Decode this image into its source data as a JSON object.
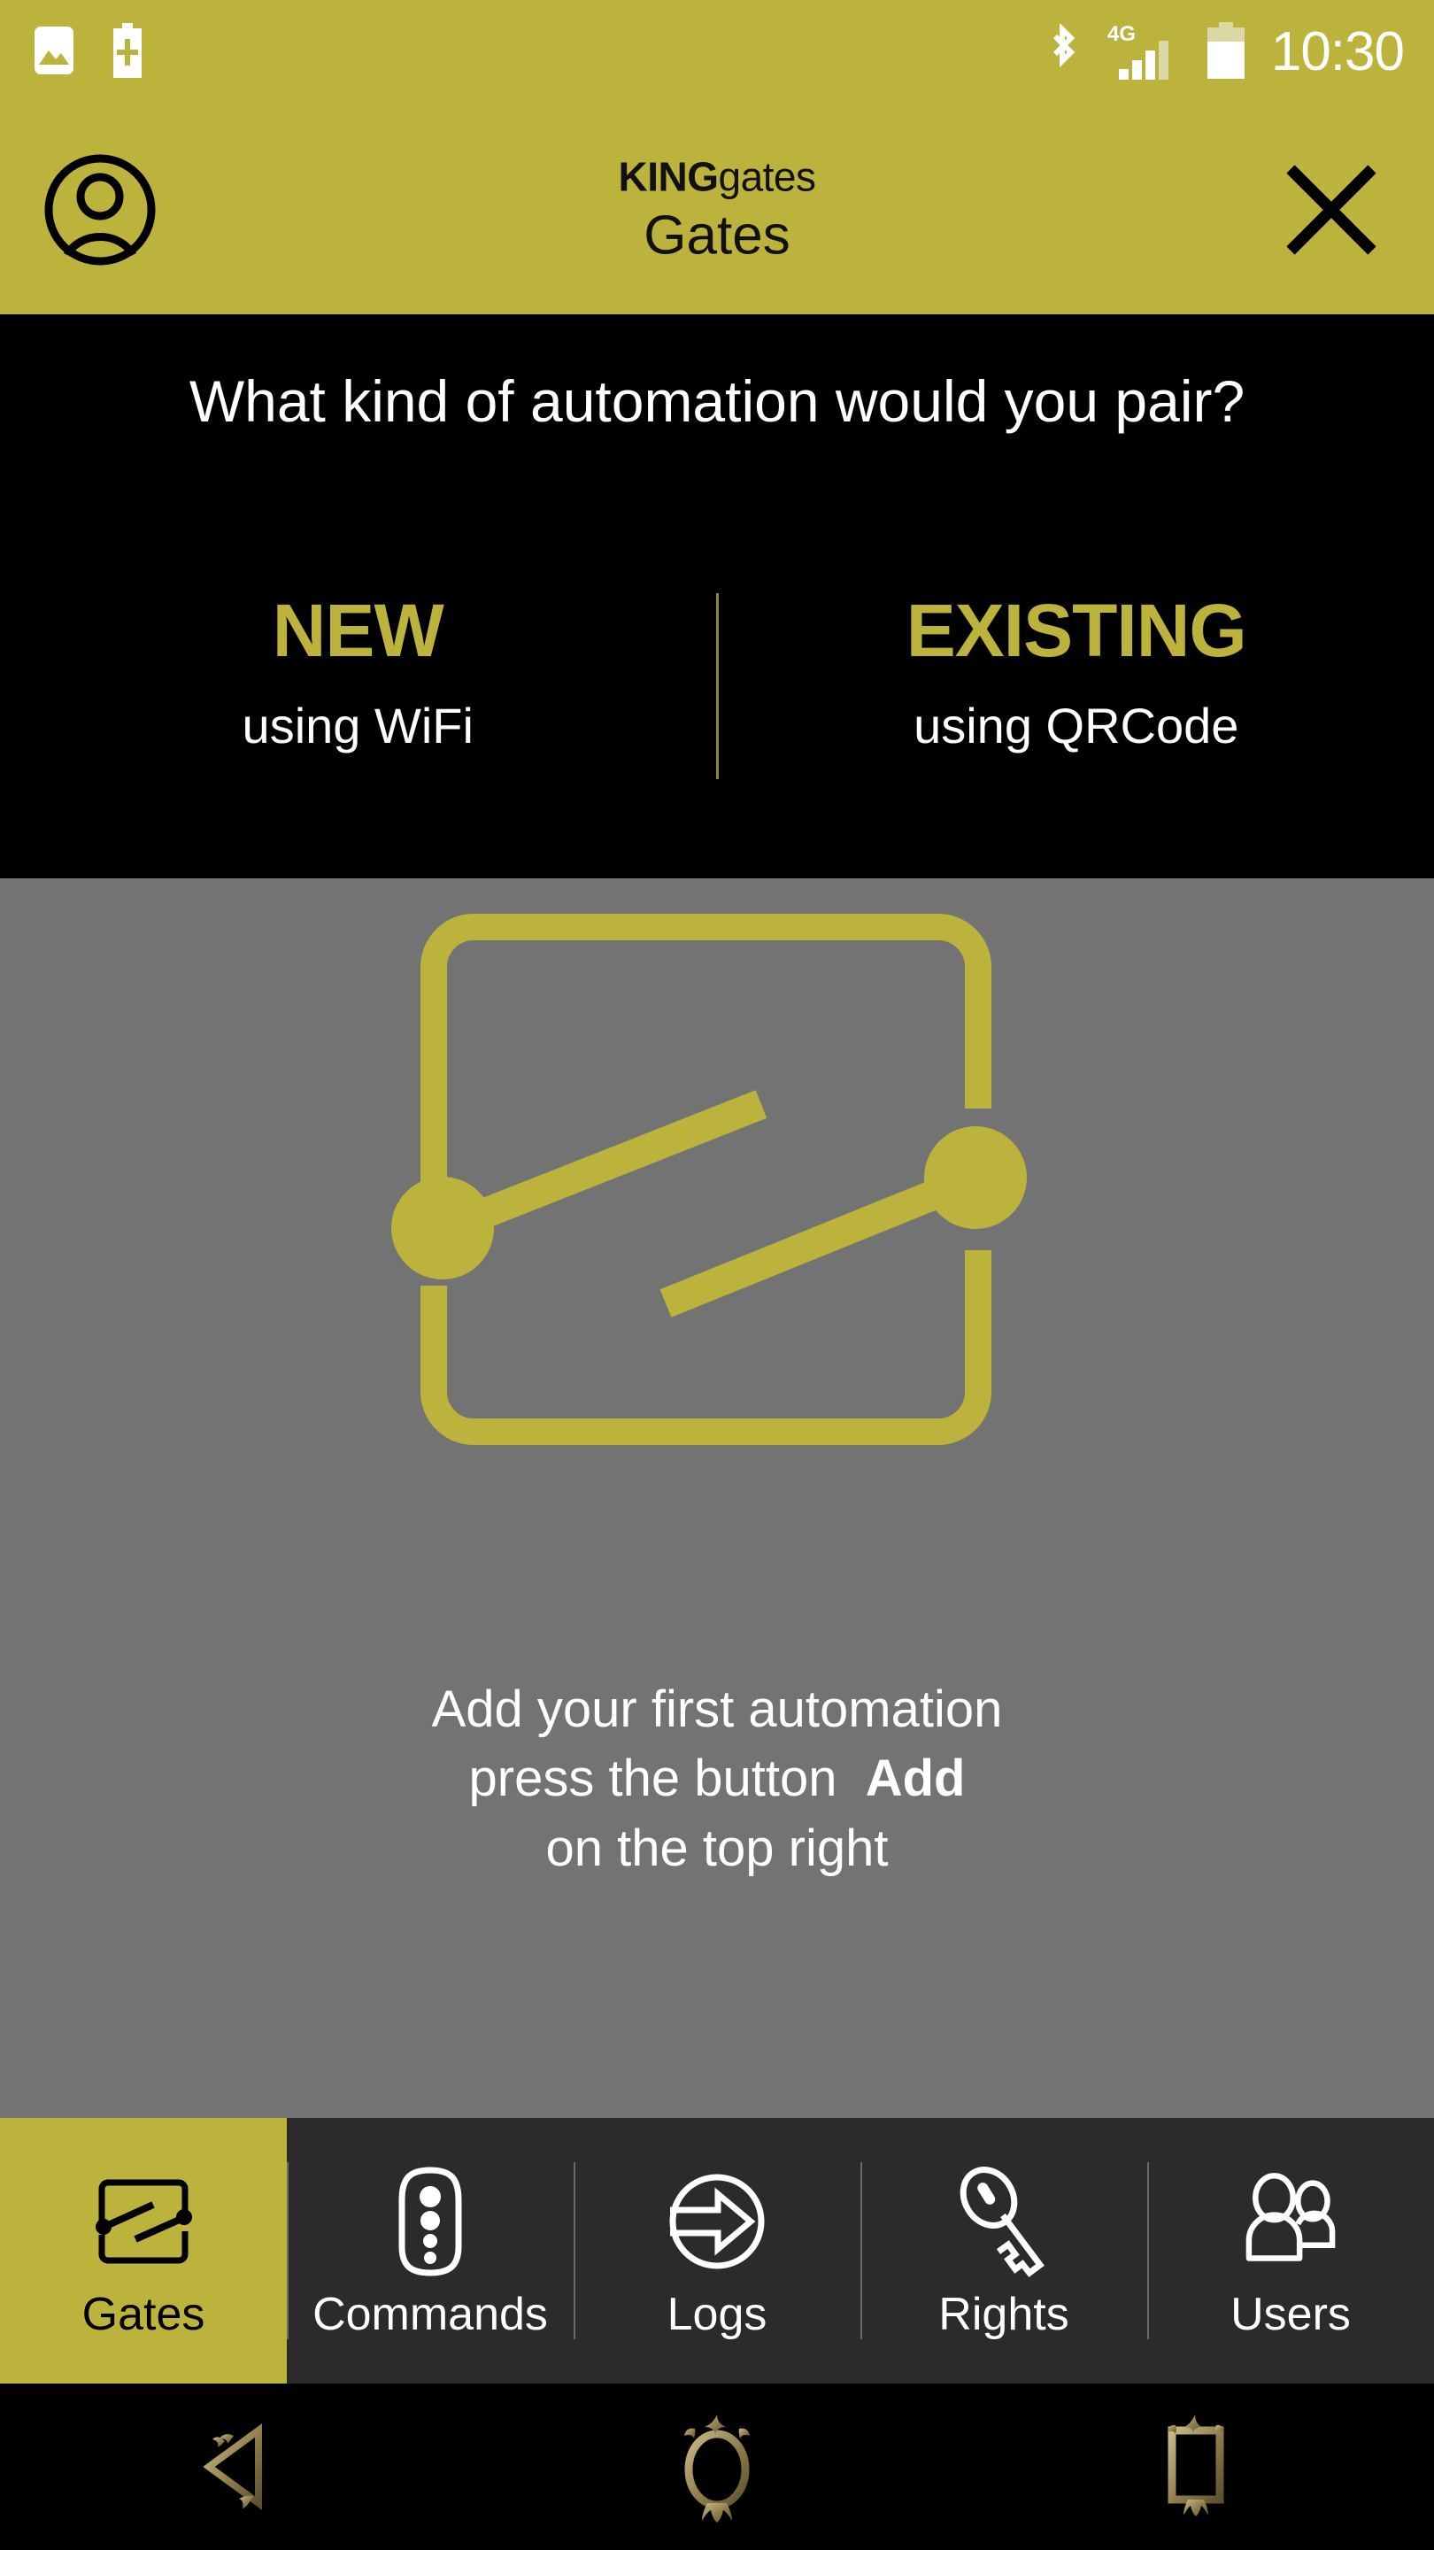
{
  "status_bar": {
    "time": "10:30",
    "left_icons": [
      "image-icon",
      "battery-plus-icon"
    ],
    "right_icons": [
      "bluetooth-icon",
      "signal-4g-icon",
      "battery-icon"
    ],
    "network_label": "4G",
    "signal_bars_filled": 3,
    "signal_bars_total": 4,
    "battery_level_percent": 70
  },
  "header": {
    "brand_bold": "KING",
    "brand_light": "gates",
    "page_title": "Gates",
    "account_icon": "account-circle-icon",
    "close_icon": "close-x-icon"
  },
  "pairing_panel": {
    "question": "What kind of automation would you pair?",
    "options": [
      {
        "title": "NEW",
        "subtitle": "using WiFi"
      },
      {
        "title": "EXISTING",
        "subtitle": "using QRCode"
      }
    ]
  },
  "empty_state": {
    "illustration": "gate-automation-icon",
    "line1": "Add your first automation",
    "line2_prefix": "press the button",
    "line2_bold": "Add",
    "line3": "on the top right"
  },
  "tabbar": {
    "items": [
      {
        "label": "Gates",
        "icon": "gate-automation-icon",
        "active": true
      },
      {
        "label": "Commands",
        "icon": "remote-control-icon",
        "active": false
      },
      {
        "label": "Logs",
        "icon": "circle-arrow-in-icon",
        "active": false
      },
      {
        "label": "Rights",
        "icon": "key-icon",
        "active": false
      },
      {
        "label": "Users",
        "icon": "users-icon",
        "active": false
      }
    ]
  },
  "system_nav": {
    "buttons": [
      "back-icon",
      "home-icon",
      "recents-icon"
    ]
  },
  "colors": {
    "brand_yellow": "#BCB33C",
    "panel_gray": "#737373",
    "panel_black": "#000000",
    "tabbar_dark": "#2B2B2B",
    "sysnav_gold": "#8a7a४5"
  }
}
